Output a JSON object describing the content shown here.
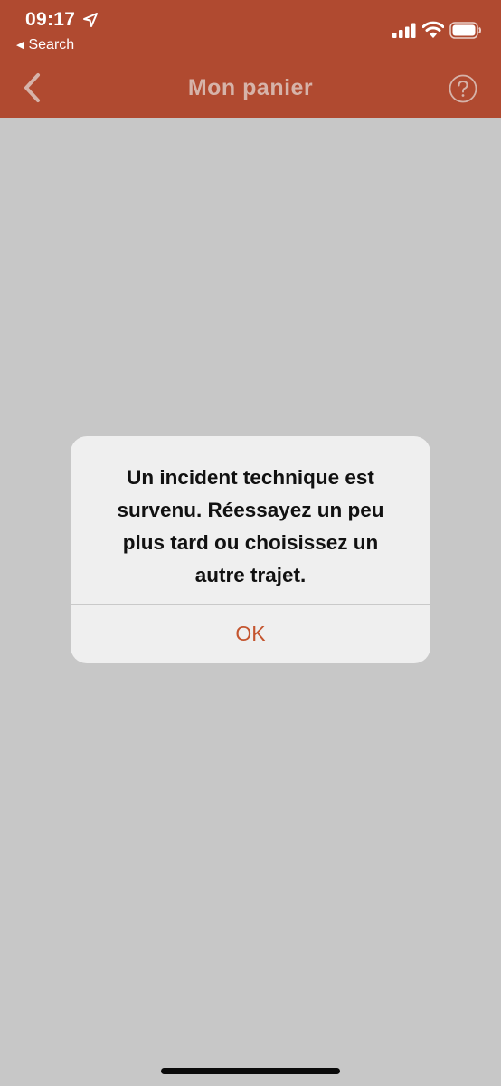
{
  "status_bar": {
    "time": "09:17",
    "back_label": "Search",
    "icons": [
      "location-arrow-icon",
      "cellular-signal-icon",
      "wifi-icon",
      "battery-icon"
    ]
  },
  "nav": {
    "title": "Mon panier",
    "icons": [
      "chevron-left-icon",
      "help-circle-icon"
    ]
  },
  "alert": {
    "message": "Un incident technique est survenu. Réessayez un peu plus tard ou choisissez un autre trajet.",
    "button_label": "OK"
  },
  "colors": {
    "brand": "#b04a30",
    "title_text": "#d6b3a9",
    "background": "#c7c7c7",
    "alert_background": "#efefef",
    "alert_button": "#c4552f"
  }
}
